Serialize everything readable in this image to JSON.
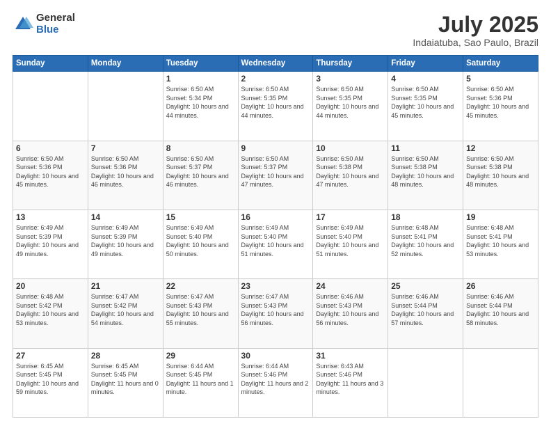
{
  "logo": {
    "general": "General",
    "blue": "Blue"
  },
  "title": "July 2025",
  "subtitle": "Indaiatuba, Sao Paulo, Brazil",
  "headers": [
    "Sunday",
    "Monday",
    "Tuesday",
    "Wednesday",
    "Thursday",
    "Friday",
    "Saturday"
  ],
  "weeks": [
    [
      {
        "day": "",
        "info": ""
      },
      {
        "day": "",
        "info": ""
      },
      {
        "day": "1",
        "info": "Sunrise: 6:50 AM\nSunset: 5:34 PM\nDaylight: 10 hours and 44 minutes."
      },
      {
        "day": "2",
        "info": "Sunrise: 6:50 AM\nSunset: 5:35 PM\nDaylight: 10 hours and 44 minutes."
      },
      {
        "day": "3",
        "info": "Sunrise: 6:50 AM\nSunset: 5:35 PM\nDaylight: 10 hours and 44 minutes."
      },
      {
        "day": "4",
        "info": "Sunrise: 6:50 AM\nSunset: 5:35 PM\nDaylight: 10 hours and 45 minutes."
      },
      {
        "day": "5",
        "info": "Sunrise: 6:50 AM\nSunset: 5:36 PM\nDaylight: 10 hours and 45 minutes."
      }
    ],
    [
      {
        "day": "6",
        "info": "Sunrise: 6:50 AM\nSunset: 5:36 PM\nDaylight: 10 hours and 45 minutes."
      },
      {
        "day": "7",
        "info": "Sunrise: 6:50 AM\nSunset: 5:36 PM\nDaylight: 10 hours and 46 minutes."
      },
      {
        "day": "8",
        "info": "Sunrise: 6:50 AM\nSunset: 5:37 PM\nDaylight: 10 hours and 46 minutes."
      },
      {
        "day": "9",
        "info": "Sunrise: 6:50 AM\nSunset: 5:37 PM\nDaylight: 10 hours and 47 minutes."
      },
      {
        "day": "10",
        "info": "Sunrise: 6:50 AM\nSunset: 5:38 PM\nDaylight: 10 hours and 47 minutes."
      },
      {
        "day": "11",
        "info": "Sunrise: 6:50 AM\nSunset: 5:38 PM\nDaylight: 10 hours and 48 minutes."
      },
      {
        "day": "12",
        "info": "Sunrise: 6:50 AM\nSunset: 5:38 PM\nDaylight: 10 hours and 48 minutes."
      }
    ],
    [
      {
        "day": "13",
        "info": "Sunrise: 6:49 AM\nSunset: 5:39 PM\nDaylight: 10 hours and 49 minutes."
      },
      {
        "day": "14",
        "info": "Sunrise: 6:49 AM\nSunset: 5:39 PM\nDaylight: 10 hours and 49 minutes."
      },
      {
        "day": "15",
        "info": "Sunrise: 6:49 AM\nSunset: 5:40 PM\nDaylight: 10 hours and 50 minutes."
      },
      {
        "day": "16",
        "info": "Sunrise: 6:49 AM\nSunset: 5:40 PM\nDaylight: 10 hours and 51 minutes."
      },
      {
        "day": "17",
        "info": "Sunrise: 6:49 AM\nSunset: 5:40 PM\nDaylight: 10 hours and 51 minutes."
      },
      {
        "day": "18",
        "info": "Sunrise: 6:48 AM\nSunset: 5:41 PM\nDaylight: 10 hours and 52 minutes."
      },
      {
        "day": "19",
        "info": "Sunrise: 6:48 AM\nSunset: 5:41 PM\nDaylight: 10 hours and 53 minutes."
      }
    ],
    [
      {
        "day": "20",
        "info": "Sunrise: 6:48 AM\nSunset: 5:42 PM\nDaylight: 10 hours and 53 minutes."
      },
      {
        "day": "21",
        "info": "Sunrise: 6:47 AM\nSunset: 5:42 PM\nDaylight: 10 hours and 54 minutes."
      },
      {
        "day": "22",
        "info": "Sunrise: 6:47 AM\nSunset: 5:43 PM\nDaylight: 10 hours and 55 minutes."
      },
      {
        "day": "23",
        "info": "Sunrise: 6:47 AM\nSunset: 5:43 PM\nDaylight: 10 hours and 56 minutes."
      },
      {
        "day": "24",
        "info": "Sunrise: 6:46 AM\nSunset: 5:43 PM\nDaylight: 10 hours and 56 minutes."
      },
      {
        "day": "25",
        "info": "Sunrise: 6:46 AM\nSunset: 5:44 PM\nDaylight: 10 hours and 57 minutes."
      },
      {
        "day": "26",
        "info": "Sunrise: 6:46 AM\nSunset: 5:44 PM\nDaylight: 10 hours and 58 minutes."
      }
    ],
    [
      {
        "day": "27",
        "info": "Sunrise: 6:45 AM\nSunset: 5:45 PM\nDaylight: 10 hours and 59 minutes."
      },
      {
        "day": "28",
        "info": "Sunrise: 6:45 AM\nSunset: 5:45 PM\nDaylight: 11 hours and 0 minutes."
      },
      {
        "day": "29",
        "info": "Sunrise: 6:44 AM\nSunset: 5:45 PM\nDaylight: 11 hours and 1 minute."
      },
      {
        "day": "30",
        "info": "Sunrise: 6:44 AM\nSunset: 5:46 PM\nDaylight: 11 hours and 2 minutes."
      },
      {
        "day": "31",
        "info": "Sunrise: 6:43 AM\nSunset: 5:46 PM\nDaylight: 11 hours and 3 minutes."
      },
      {
        "day": "",
        "info": ""
      },
      {
        "day": "",
        "info": ""
      }
    ]
  ]
}
